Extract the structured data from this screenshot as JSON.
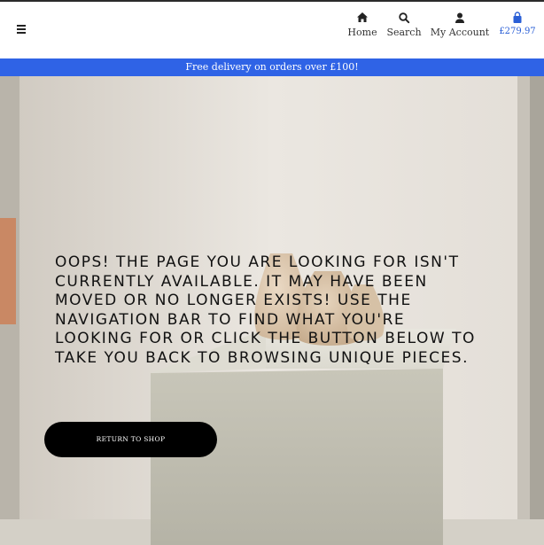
{
  "header": {
    "menu_icon": "hamburger-icon",
    "nav": {
      "home": {
        "icon": "home-icon",
        "label": "Home"
      },
      "search": {
        "icon": "search-icon",
        "label": "Search"
      },
      "account": {
        "icon": "user-icon",
        "label": "My Account"
      },
      "cart": {
        "icon": "shopping-bag-icon",
        "label": "£279.97"
      }
    }
  },
  "banner": {
    "text": "Free delivery on orders over £100!"
  },
  "hero": {
    "message": "Oops! The page you are looking for isn't currently available. It may have been moved or no longer exists! Use the navigation bar to find what you're looking for or click the button below to take you back to browsing unique pieces.",
    "button_label": "RETURN TO SHOP"
  },
  "colors": {
    "accent": "#2f63e6",
    "button": "#000000",
    "cart_text": "#2a5fd6"
  }
}
